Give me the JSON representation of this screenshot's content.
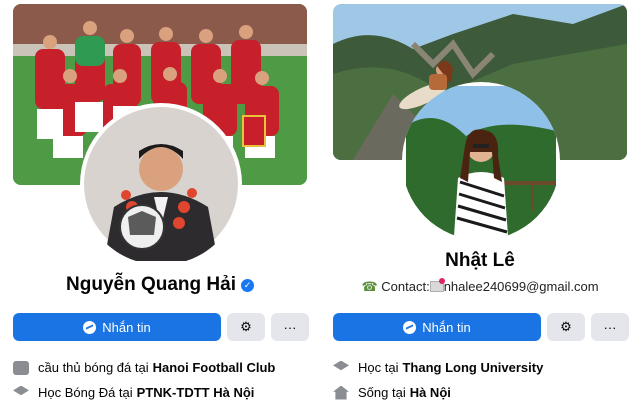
{
  "profiles": [
    {
      "name": "Nguyễn Quang Hải",
      "verified": true,
      "message_button": "Nhắn tin",
      "settings_icon": "gear-icon",
      "more_button": "···",
      "info": [
        {
          "icon": "briefcase-icon",
          "prefix": "cầu thủ bóng đá tại",
          "value": "Hanoi Football Club"
        },
        {
          "icon": "graduation-cap-icon",
          "prefix": "Học Bóng Đá tại",
          "value": "PTNK-TDTT Hà Nội"
        }
      ]
    },
    {
      "name": "Nhật Lê",
      "bio_prefix": "Contact:",
      "bio_email": "nhalee240699@gmail.com",
      "message_button": "Nhắn tin",
      "settings_icon": "gear-icon",
      "more_button": "···",
      "info": [
        {
          "icon": "graduation-cap-icon",
          "prefix": "Học tại",
          "value": "Thang Long University"
        },
        {
          "icon": "home-icon",
          "prefix": "Sống tại",
          "value": "Hà Nội"
        }
      ]
    }
  ]
}
